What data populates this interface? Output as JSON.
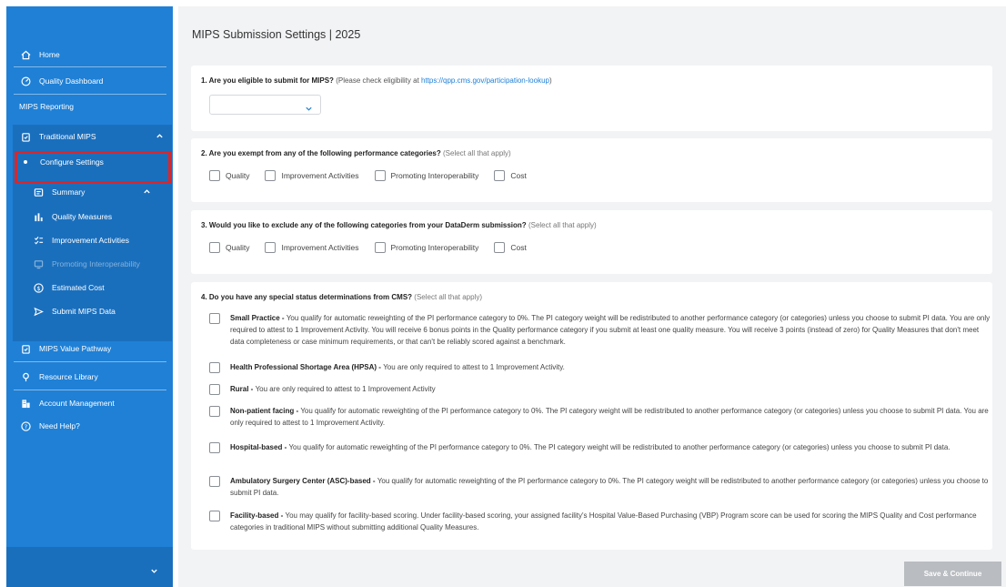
{
  "sidebar": {
    "home": "Home",
    "quality_dashboard": "Quality Dashboard",
    "mips_reporting": "MIPS Reporting",
    "traditional_mips": "Traditional MIPS",
    "configure_settings": "Configure Settings",
    "summary": "Summary",
    "quality_measures": "Quality Measures",
    "improvement_activities": "Improvement Activities",
    "promoting_interoperability": "Promoting Interoperability",
    "estimated_cost": "Estimated Cost",
    "submit_mips_data": "Submit MIPS Data",
    "mips_value_pathway": "MIPS Value Pathway",
    "resource_library": "Resource Library",
    "account_management": "Account Management",
    "need_help": "Need Help?"
  },
  "page": {
    "title": "MIPS Submission Settings | 2025"
  },
  "q1": {
    "question": "1. Are you eligible to submit for MIPS?",
    "note": "(Please check eligibility at ",
    "link": "https://qpp.cms.gov/participation-lookup",
    "note_end": ")",
    "select_value": ""
  },
  "q2": {
    "question": "2. Are you exempt from any of the following performance categories?",
    "note": "(Select all that apply)",
    "options": [
      "Quality",
      "Improvement Activities",
      "Promoting Interoperability",
      "Cost"
    ]
  },
  "q3": {
    "question": "3. Would you like to exclude any of the following categories from your DataDerm submission?",
    "note": "(Select all that apply)",
    "options": [
      "Quality",
      "Improvement Activities",
      "Promoting Interoperability",
      "Cost"
    ]
  },
  "q4": {
    "question": "4. Do you have any special status determinations from CMS?",
    "note": "(Select all that apply)",
    "items": [
      {
        "title": "Small Practice - ",
        "text": "You qualify for automatic reweighting of the PI performance category to 0%. The PI category weight will be redistributed to another performance category (or categories) unless you choose to submit PI data. You are only required to attest to 1 Improvement Activity. You will receive 6 bonus points in the Quality performance category if you submit at least one quality measure. You will receive 3 points (instead of zero) for Quality Measures that don't meet data completeness or case minimum requirements, or that can't be reliably scored against a benchmark."
      },
      {
        "title": "Health Professional Shortage Area (HPSA) - ",
        "text": "You are only required to attest to 1 Improvement Activity."
      },
      {
        "title": "Rural - ",
        "text": "You are only required to attest to 1 Improvement Activity"
      },
      {
        "title": "Non-patient facing - ",
        "text": "You qualify for automatic reweighting of the PI performance category to 0%. The PI category weight will be redistributed to another performance category (or categories) unless you choose to submit PI data. You are only required to attest to 1 Improvement Activity."
      },
      {
        "title": "Hospital-based - ",
        "text": "You qualify for automatic reweighting of the PI performance category to 0%. The PI category weight will be redistributed to another performance category (or categories) unless you choose to submit PI data."
      },
      {
        "title": "Ambulatory Surgery Center (ASC)-based - ",
        "text": "You qualify for automatic reweighting of the PI performance category to 0%. The PI category weight will be redistributed to another performance category (or categories) unless you choose to submit PI data."
      },
      {
        "title": "Facility-based - ",
        "text": "You may qualify for facility-based scoring. Under facility-based scoring, your assigned facility's Hospital Value-Based Purchasing (VBP) Program score can be used for scoring the MIPS Quality and Cost performance categories in traditional MIPS without submitting additional Quality Measures."
      }
    ]
  },
  "footer": {
    "save_label": "Save & Continue"
  },
  "colors": {
    "sidebar": "#1f80d6",
    "sidebar_dark": "#1a6fbd",
    "highlight": "#d7272d",
    "link": "#1f80d6",
    "background": "#f2f3f5",
    "disabled_button": "#b9bcc0"
  }
}
